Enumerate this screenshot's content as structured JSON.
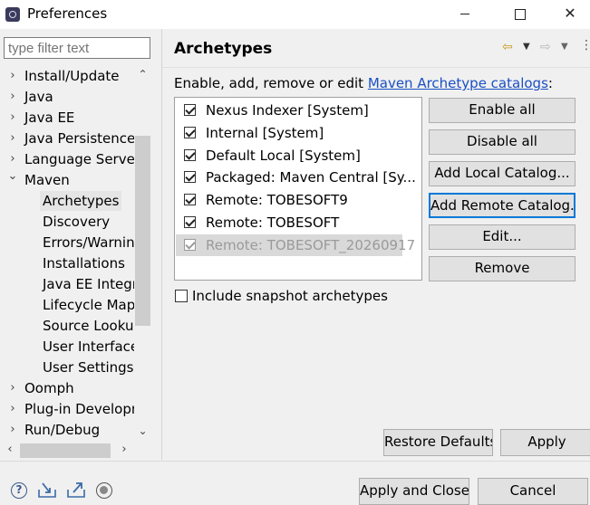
{
  "window": {
    "title": "Preferences"
  },
  "filter": {
    "placeholder": "type filter text"
  },
  "tree": {
    "items": [
      {
        "label": "Install/Update",
        "chevron": "right",
        "indent": 0
      },
      {
        "label": "Java",
        "chevron": "right",
        "indent": 0
      },
      {
        "label": "Java EE",
        "chevron": "right",
        "indent": 0
      },
      {
        "label": "Java Persistence",
        "chevron": "right",
        "indent": 0
      },
      {
        "label": "Language Servers",
        "chevron": "right",
        "indent": 0
      },
      {
        "label": "Maven",
        "chevron": "down",
        "indent": 0
      },
      {
        "label": "Archetypes",
        "chevron": "",
        "indent": 1,
        "selected": true
      },
      {
        "label": "Discovery",
        "chevron": "",
        "indent": 1
      },
      {
        "label": "Errors/Warnings",
        "chevron": "",
        "indent": 1
      },
      {
        "label": "Installations",
        "chevron": "",
        "indent": 1
      },
      {
        "label": "Java EE Integration",
        "chevron": "",
        "indent": 1
      },
      {
        "label": "Lifecycle Mappings",
        "chevron": "",
        "indent": 1
      },
      {
        "label": "Source Lookup",
        "chevron": "",
        "indent": 1
      },
      {
        "label": "User Interface",
        "chevron": "",
        "indent": 1
      },
      {
        "label": "User Settings",
        "chevron": "",
        "indent": 1
      },
      {
        "label": "Oomph",
        "chevron": "right",
        "indent": 0
      },
      {
        "label": "Plug-in Development",
        "chevron": "right",
        "indent": 0
      },
      {
        "label": "Run/Debug",
        "chevron": "right",
        "indent": 0
      }
    ]
  },
  "page": {
    "title": "Archetypes",
    "description_prefix": "Enable, add, remove or edit ",
    "description_link": "Maven Archetype catalogs",
    "description_suffix": ":"
  },
  "catalogs": [
    {
      "label": "Nexus Indexer [System]",
      "checked": true
    },
    {
      "label": "Internal [System]",
      "checked": true
    },
    {
      "label": "Default Local [System]",
      "checked": true
    },
    {
      "label": "Packaged: Maven Central [Sy...",
      "checked": true
    },
    {
      "label": "Remote: TOBESOFT9",
      "checked": true
    },
    {
      "label": "Remote: TOBESOFT",
      "checked": true
    },
    {
      "label": "Remote: TOBESOFT_20260917",
      "checked": true,
      "selected": true,
      "dimmed": true
    }
  ],
  "buttons": {
    "enable_all": "Enable all",
    "disable_all": "Disable all",
    "add_local": "Add Local Catalog...",
    "add_remote": "Add Remote Catalog...",
    "edit": "Edit...",
    "remove": "Remove",
    "restore_defaults": "Restore Defaults",
    "apply": "Apply",
    "apply_and_close": "Apply and Close",
    "cancel": "Cancel"
  },
  "snapshot": {
    "label": "Include snapshot archetypes",
    "checked": false
  },
  "colors": {
    "link": "#1a4fc4",
    "focus": "#0078d7",
    "selection": "#d9d9d9"
  }
}
